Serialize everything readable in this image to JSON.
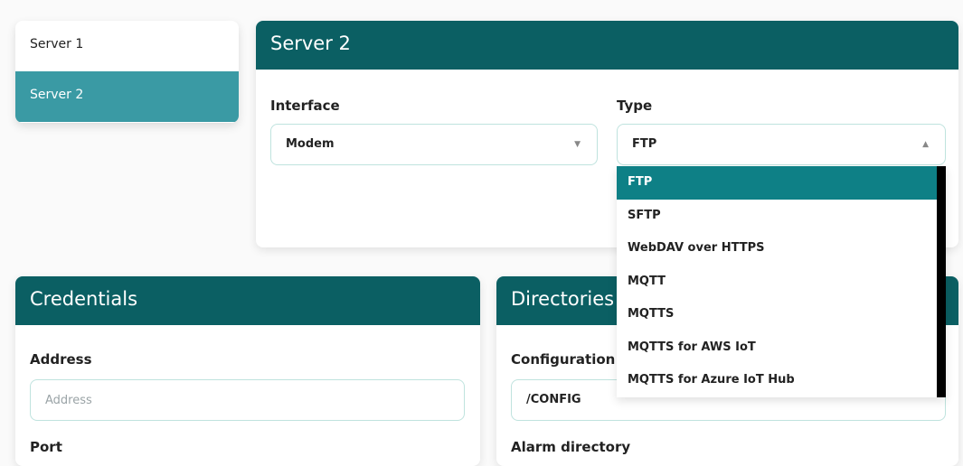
{
  "sidebar": {
    "items": [
      {
        "label": "Server 1"
      },
      {
        "label": "Server 2"
      }
    ]
  },
  "server_card": {
    "title": "Server 2",
    "interface": {
      "label": "Interface",
      "value": "Modem"
    },
    "type": {
      "label": "Type",
      "value": "FTP",
      "options": [
        "FTP",
        "SFTP",
        "WebDAV over HTTPS",
        "MQTT",
        "MQTTS",
        "MQTTS for AWS IoT",
        "MQTTS for Azure IoT Hub"
      ]
    }
  },
  "credentials": {
    "title": "Credentials",
    "address_label": "Address",
    "address_placeholder": "Address",
    "port_label": "Port"
  },
  "directories": {
    "title": "Directories",
    "configuration_label": "Configuration",
    "configuration_value": "/CONFIG",
    "alarm_label": "Alarm directory"
  },
  "colors": {
    "header": "#0b5f63",
    "active_item": "#3a9aa4",
    "selected_option": "#0e8086",
    "field_border": "#bfe3de"
  }
}
